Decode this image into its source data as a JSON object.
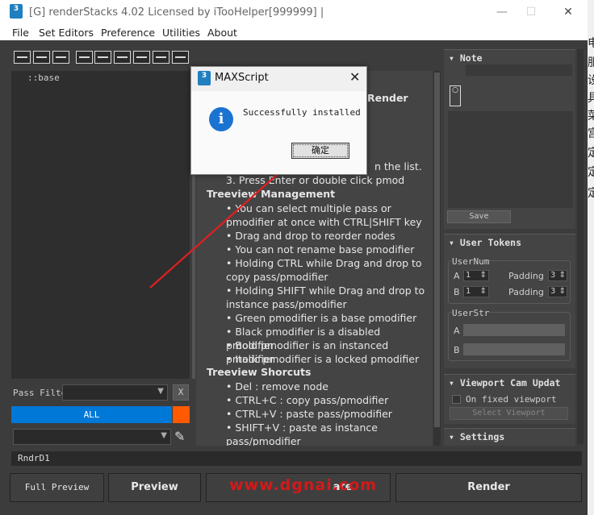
{
  "window": {
    "title": "[G] renderStacks 4.02 Licensed by iTooHelper[999999] |",
    "icon_text": "3",
    "controls": [
      "minimize-icon",
      "maximize-icon",
      "close-icon"
    ]
  },
  "menu": [
    "File",
    "Set Editors",
    "Preference",
    "Utilities",
    "About"
  ],
  "right_strip": [
    "电",
    "服",
    "设",
    "具",
    "菜",
    "宫",
    "定",
    "定",
    "定"
  ],
  "tree": {
    "root": "::base"
  },
  "filter": {
    "label": "Pass Filte",
    "clear": "X",
    "all_label": "ALL"
  },
  "help": {
    "render_heading": "Render",
    "frag1": "n the list.",
    "step3": "3. Press Enter or double click pmod",
    "treeview_mgmt": "Treeview Management",
    "mgmt_items": [
      "You can select multiple pass or pmodifier at once with CTRL|SHIFT key",
      "Drag and drop to reorder nodes",
      "You can not rename base pmodifier",
      "Holding CTRL while Drag and drop to copy pass/pmodifier",
      "Holding SHIFT while Drag and drop to instance pass/pmodifier",
      "Green pmodifier is a base pmodifier",
      "Black pmodifier is a disabled pmodifier",
      "Bold pmodifier is an instanced pmodifier",
      "Italic pmodifier is a locked pmodifier"
    ],
    "treeview_shortcuts": "Treeview Shorcuts",
    "shortcut_items": [
      "Del : remove node",
      "CTRL+C : copy pass/pmodifier",
      "CTRL+V : paste pass/pmodifier",
      "SHIFT+V : paste as instance pass/pmodifier"
    ]
  },
  "note": {
    "title": "Note",
    "save": "Save"
  },
  "user_tokens": {
    "title": "User Tokens",
    "usernum": "UserNum",
    "a": "A",
    "b": "B",
    "a_value": "1",
    "b_value": "1",
    "padding": "Padding",
    "pad_a": "3",
    "pad_b": "3",
    "userstr": "UserStr",
    "str_a": "A",
    "str_b": "B"
  },
  "viewport": {
    "title": "Viewport Cam Updat",
    "checkbox": "On fixed viewport",
    "button": "Select Viewport"
  },
  "settings": {
    "title": "Settings"
  },
  "status": "RndrD1",
  "bottom": {
    "full_preview": "Full Preview",
    "preview": "Preview",
    "middle": "ate",
    "render": "Render"
  },
  "dialog": {
    "title": "MAXScript",
    "message": "Successfully installed",
    "ok": "确定"
  },
  "watermark": "www.dgnai.com",
  "colors": {
    "accent_blue": "#0078d7",
    "accent_orange": "#ff5a00",
    "arrow_red": "#e02020"
  }
}
